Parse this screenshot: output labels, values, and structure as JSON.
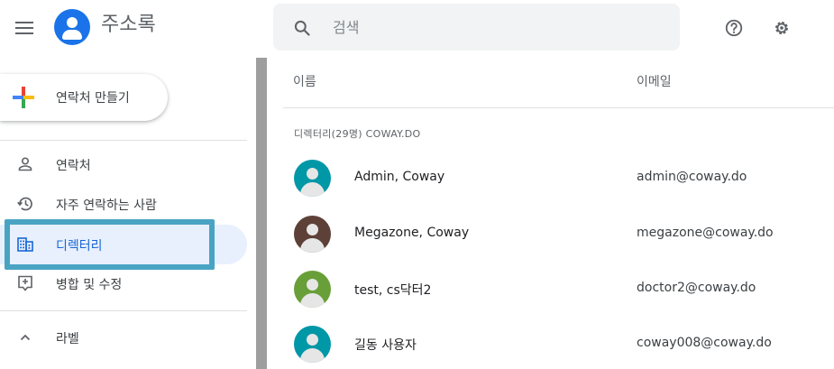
{
  "header": {
    "title": "주소록",
    "search_placeholder": "검색",
    "brand_color": "#1a73e8"
  },
  "sidebar": {
    "create_label": "연락처 만들기",
    "items": [
      {
        "label": "연락처",
        "icon": "person-icon"
      },
      {
        "label": "자주 연락하는 사람",
        "icon": "history-icon"
      },
      {
        "label": "디렉터리",
        "icon": "building-icon",
        "active": true
      },
      {
        "label": "병합 및 수정",
        "icon": "merge-fix-icon"
      }
    ],
    "labels_label": "라벨"
  },
  "table": {
    "columns": [
      "이름",
      "이메일"
    ],
    "section_label": "디렉터리(29명) COWAY.DO",
    "rows": [
      {
        "name": "Admin, Coway",
        "email": "admin@coway.do",
        "avatar_color": "#0097a7"
      },
      {
        "name": "Megazone, Coway",
        "email": "megazone@coway.do",
        "avatar_color": "#5d4037"
      },
      {
        "name": "test, cs닥터2",
        "email": "doctor2@coway.do",
        "avatar_color": "#689f38"
      },
      {
        "name": "길동 사용자",
        "email": "coway008@coway.do",
        "avatar_color": "#0097a7"
      }
    ]
  }
}
